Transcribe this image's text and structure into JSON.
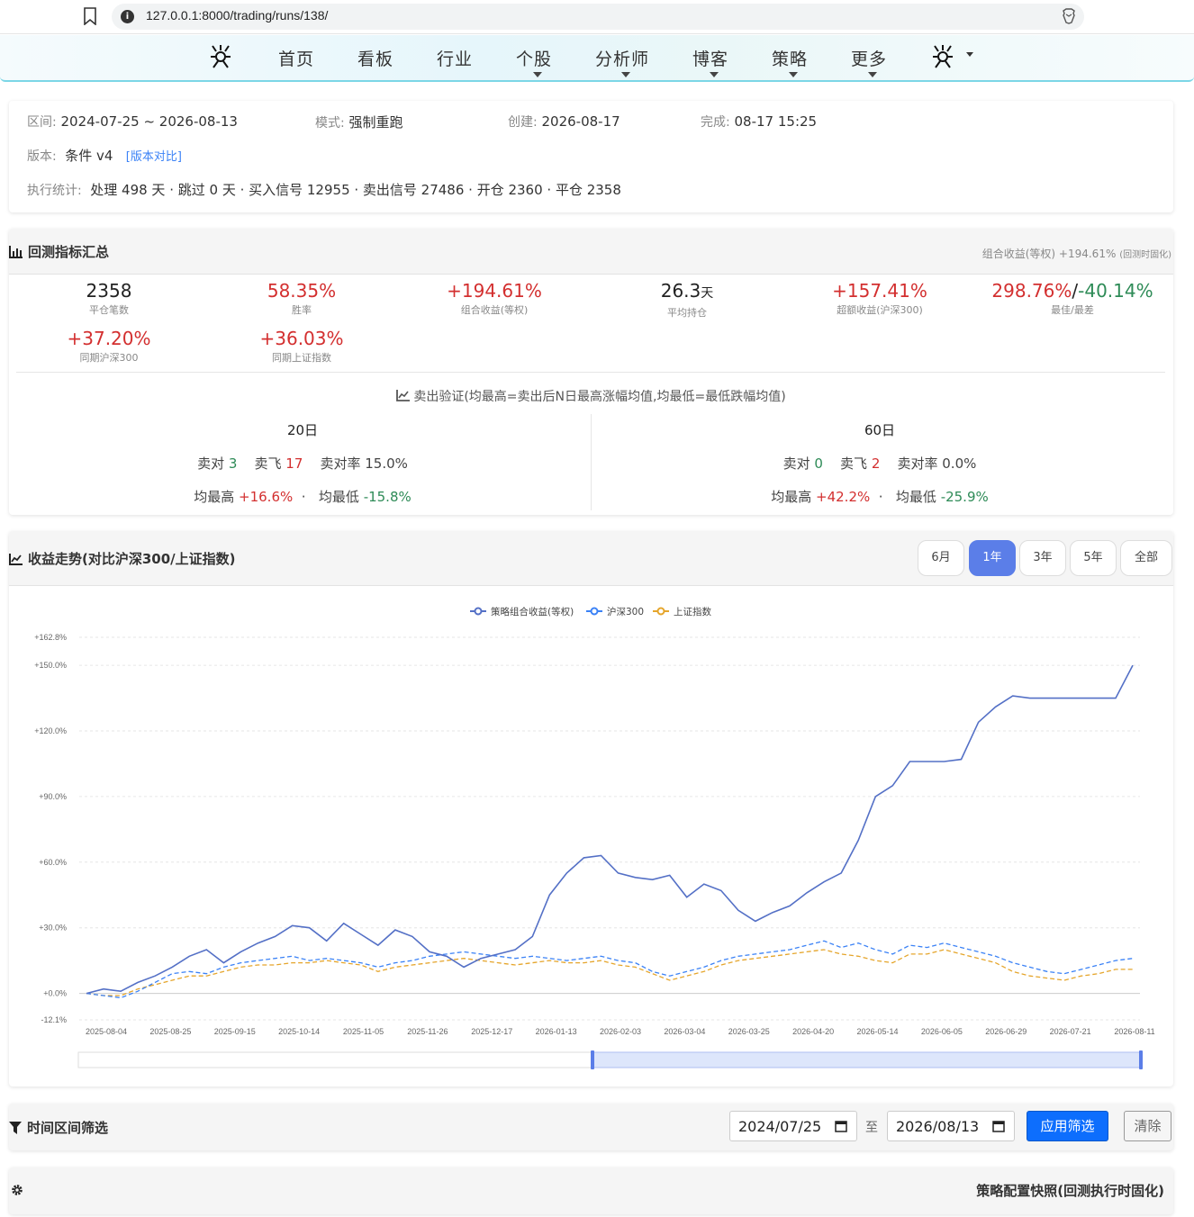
{
  "browser": {
    "url": "127.0.0.1:8000/trading/runs/138/"
  },
  "nav": {
    "items": [
      "首页",
      "看板",
      "行业",
      "个股",
      "分析师",
      "博客",
      "策略",
      "更多"
    ]
  },
  "info": {
    "range_label": "区间:",
    "range_value": "2024-07-25 ~ 2026-08-13",
    "mode_label": "模式:",
    "mode_value": "强制重跑",
    "created_label": "创建:",
    "created_value": "2026-08-17",
    "done_label": "完成:",
    "done_value": "08-17 15:25",
    "version_label": "版本:",
    "version_value": "条件 v4",
    "version_link": "[版本对比]",
    "stats_label": "执行统计:",
    "stats_value": "处理 498 天 · 跳过 0 天 · 买入信号 12955 · 卖出信号 27486 · 开仓 2360 · 平仓 2358"
  },
  "metrics": {
    "title": "回测指标汇总",
    "header_right": "组合收益(等权) +194.61%",
    "header_right_note": "(回测时固化)",
    "items": [
      {
        "value": "2358",
        "unit": "",
        "label": "平仓笔数"
      },
      {
        "value": "58.35%",
        "unit": "",
        "label": "胜率"
      },
      {
        "value": "+194.61%",
        "unit": "",
        "label": "组合收益(等权)"
      },
      {
        "value": "26.3",
        "unit": "天",
        "label": "平均持仓"
      },
      {
        "value": "+157.41%",
        "unit": "",
        "label": "超额收益(沪深300)"
      },
      {
        "value": "298.76%",
        "value2": "-40.14%",
        "sep": "/",
        "label": "最佳/最差"
      },
      {
        "value": "+37.20%",
        "unit": "",
        "label": "同期沪深300"
      },
      {
        "value": "+36.03%",
        "unit": "",
        "label": "同期上证指数"
      }
    ],
    "sell_title": "卖出验证(均最高=卖出后N日最高涨幅均值,均最低=最低跌幅均值)",
    "periods": [
      {
        "name": "20日",
        "right_label": "卖对",
        "right": "3",
        "fly_label": "卖飞",
        "fly": "17",
        "rate_label": "卖对率",
        "rate": "15.0%",
        "hi_label": "均最高",
        "hi": "+16.6%",
        "dot": "·",
        "lo_label": "均最低",
        "lo": "-15.8%"
      },
      {
        "name": "60日",
        "right_label": "卖对",
        "right": "0",
        "fly_label": "卖飞",
        "fly": "2",
        "rate_label": "卖对率",
        "rate": "0.0%",
        "hi_label": "均最高",
        "hi": "+42.2%",
        "dot": "·",
        "lo_label": "均最低",
        "lo": "-25.9%"
      }
    ]
  },
  "chart_section": {
    "title": "收益走势(对比沪深300/上证指数)",
    "ranges": [
      "6月",
      "1年",
      "3年",
      "5年",
      "全部"
    ],
    "active_range": "1年"
  },
  "chart_data": {
    "type": "line",
    "y_ticks": [
      "+162.8%",
      "+150.0%",
      "+120.0%",
      "+90.0%",
      "+60.0%",
      "+30.0%",
      "+0.0%",
      "-12.1%"
    ],
    "y_tick_values": [
      162.8,
      150,
      120,
      90,
      60,
      30,
      0,
      -12.1
    ],
    "ylim": [
      -12.1,
      162.8
    ],
    "x_ticks": [
      "2025-08-04",
      "2025-08-25",
      "2025-09-15",
      "2025-10-14",
      "2025-11-05",
      "2025-11-26",
      "2025-12-17",
      "2026-01-13",
      "2026-02-03",
      "2026-03-04",
      "2026-03-25",
      "2026-04-20",
      "2026-05-14",
      "2026-06-05",
      "2026-06-29",
      "2026-07-21",
      "2026-08-11"
    ],
    "legend_position": "top-center",
    "grid": true,
    "series": [
      {
        "name": "策略组合收益(等权)",
        "color": "#5470c6",
        "dashed": false,
        "values": [
          0,
          2,
          1,
          5,
          8,
          12,
          17,
          20,
          14,
          19,
          23,
          26,
          31,
          30,
          24,
          32,
          27,
          22,
          29,
          26,
          19,
          17,
          12,
          16,
          18,
          20,
          26,
          45,
          55,
          62,
          63,
          55,
          53,
          52,
          54,
          44,
          50,
          47,
          38,
          33,
          37,
          40,
          46,
          51,
          55,
          70,
          90,
          95,
          106,
          106,
          106,
          107,
          124,
          131,
          136,
          135,
          135,
          135,
          135,
          135,
          135,
          150
        ]
      },
      {
        "name": "沪深300",
        "color": "#3b82f6",
        "dashed": true,
        "values": [
          0,
          -1,
          -2,
          1,
          5,
          9,
          10,
          9,
          12,
          14,
          15,
          16,
          17,
          15,
          16,
          15,
          14,
          12,
          14,
          15,
          17,
          18,
          19,
          18,
          17,
          16,
          17,
          16,
          15,
          16,
          17,
          15,
          14,
          10,
          8,
          10,
          12,
          15,
          17,
          18,
          19,
          20,
          22,
          24,
          21,
          23,
          20,
          18,
          22,
          21,
          23,
          21,
          19,
          17,
          14,
          12,
          10,
          9,
          11,
          13,
          15,
          16
        ]
      },
      {
        "name": "上证指数",
        "color": "#e5a52b",
        "dashed": true,
        "values": [
          0,
          -1,
          -1,
          2,
          4,
          6,
          8,
          8,
          10,
          12,
          13,
          13,
          14,
          14,
          15,
          14,
          13,
          10,
          12,
          13,
          14,
          15,
          16,
          15,
          14,
          13,
          14,
          15,
          14,
          14,
          15,
          13,
          12,
          9,
          6,
          8,
          10,
          13,
          15,
          16,
          17,
          18,
          19,
          20,
          18,
          17,
          15,
          14,
          18,
          18,
          20,
          18,
          16,
          14,
          10,
          8,
          7,
          6,
          8,
          9,
          11,
          11
        ]
      }
    ]
  },
  "filter": {
    "title": "时间区间筛选",
    "from": "2024/07/25",
    "to_label": "至",
    "to": "2026/08/13",
    "apply": "应用筛选",
    "clear": "清除"
  },
  "config": {
    "title": "策略配置快照(回测执行时固化)"
  }
}
